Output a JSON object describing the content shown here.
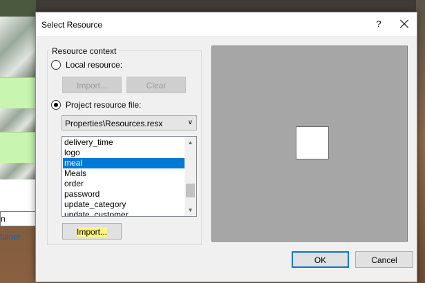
{
  "background": {
    "field_value": "n",
    "link_text": "tainer"
  },
  "dialog": {
    "title": "Select Resource",
    "help_label": "?",
    "group_label": "Resource context",
    "local_resource": {
      "label": "Local resource:",
      "checked": false
    },
    "import_top_label": "Import...",
    "clear_label": "Clear",
    "project_resource": {
      "label": "Project resource file:",
      "checked": true
    },
    "resource_file": "Properties\\Resources.resx",
    "resources": [
      "delivery_time",
      "logo",
      "meal",
      "Meals",
      "order",
      "password",
      "update_category",
      "update_customer"
    ],
    "selected_resource": "meal",
    "import_bottom_label": "Import...",
    "ok_label": "OK",
    "cancel_label": "Cancel"
  },
  "colors": {
    "selection": "#0078d7",
    "highlight": "#fff77a",
    "preview_bg": "#a6a6a6"
  },
  "icons": {
    "close": "close-icon",
    "dropdown": "chevron-down-icon",
    "scroll_up": "scroll-up-icon",
    "scroll_down": "scroll-down-icon"
  }
}
